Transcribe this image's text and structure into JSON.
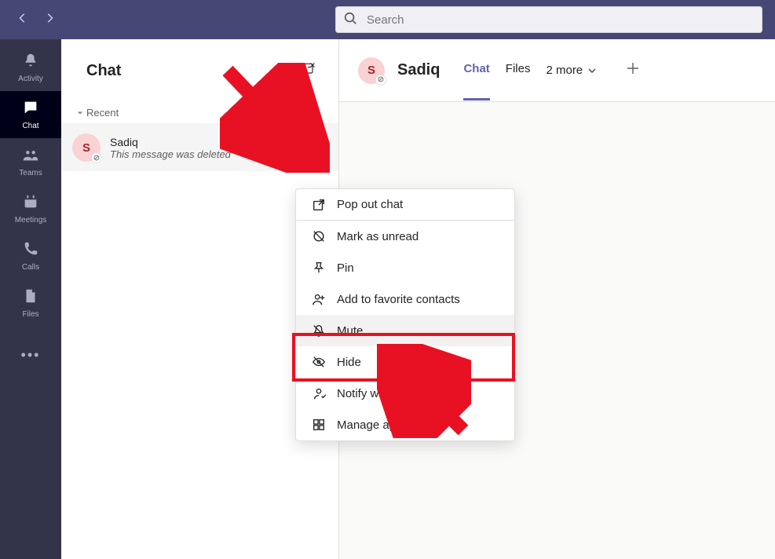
{
  "search": {
    "placeholder": "Search"
  },
  "rail": {
    "items": [
      {
        "label": "Activity"
      },
      {
        "label": "Chat"
      },
      {
        "label": "Teams"
      },
      {
        "label": "Meetings"
      },
      {
        "label": "Calls"
      },
      {
        "label": "Files"
      }
    ]
  },
  "chat_list": {
    "title": "Chat",
    "section": "Recent",
    "item": {
      "avatar_letter": "S",
      "name": "Sadiq",
      "preview": "This message was deleted"
    }
  },
  "conversation": {
    "avatar_letter": "S",
    "name": "Sadiq",
    "tabs": [
      {
        "label": "Chat"
      },
      {
        "label": "Files"
      }
    ],
    "more_tabs_label": "2 more"
  },
  "context_menu": {
    "items": [
      "Pop out chat",
      "Mark as unread",
      "Pin",
      "Add to favorite contacts",
      "Mute",
      "Hide",
      "Notify when available",
      "Manage apps"
    ]
  }
}
